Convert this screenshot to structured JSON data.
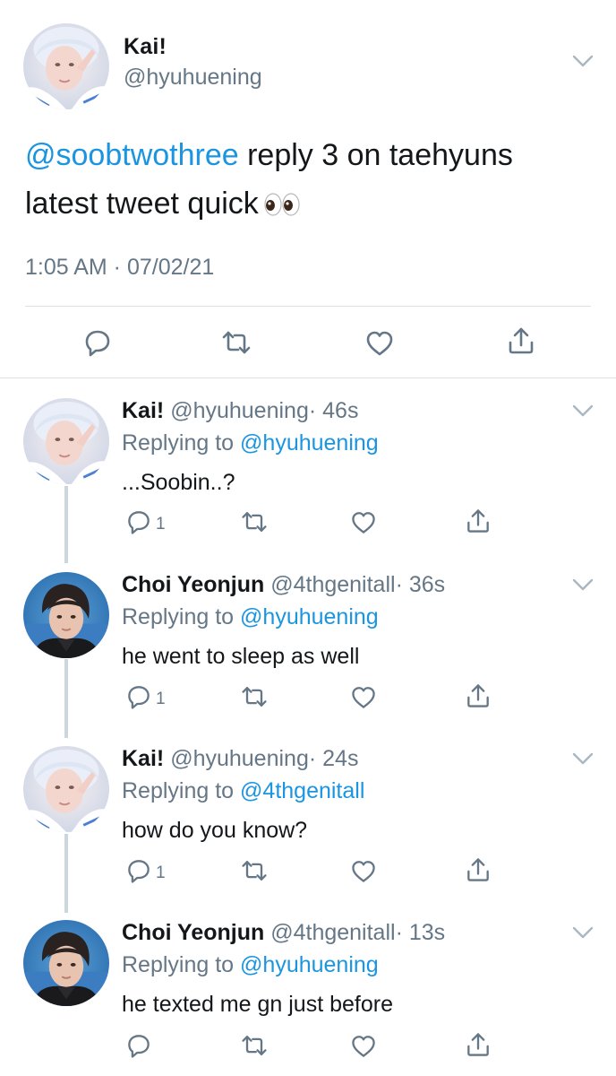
{
  "main_tweet": {
    "name": "Kai!",
    "handle": "@hyuhuening",
    "mention": "@soobtwothree",
    "text_line1": " reply 3 on taehyuns",
    "text_line2": "latest tweet quick",
    "emoji": "eyes-emoji",
    "timestamp": "1:05 AM · 07/02/21"
  },
  "replies": [
    {
      "name": "Kai!",
      "handle": "@hyuhuening",
      "age": "· 46s",
      "replying_prefix": "Replying to ",
      "replying_to": "@hyuhuening",
      "text": "...Soobin..?",
      "reply_count": "1"
    },
    {
      "name": "Choi Yeonjun",
      "handle": "@4thgenitall",
      "age": "· 36s",
      "replying_prefix": "Replying to ",
      "replying_to": "@hyuhuening",
      "text": "he went to sleep as well",
      "reply_count": "1"
    },
    {
      "name": "Kai!",
      "handle": "@hyuhuening",
      "age": "· 24s",
      "replying_prefix": "Replying to ",
      "replying_to": "@4thgenitall",
      "text": "how do you know?",
      "reply_count": "1"
    },
    {
      "name": "Choi Yeonjun",
      "handle": "@4thgenitall",
      "age": "· 13s",
      "replying_prefix": "Replying to ",
      "replying_to": "@hyuhuening",
      "text": "he texted me gn just before",
      "reply_count": ""
    }
  ],
  "colors": {
    "link": "#1b95e0",
    "muted": "#657786",
    "divider": "#dfe3e8",
    "thread_line": "#ccd6dd"
  }
}
